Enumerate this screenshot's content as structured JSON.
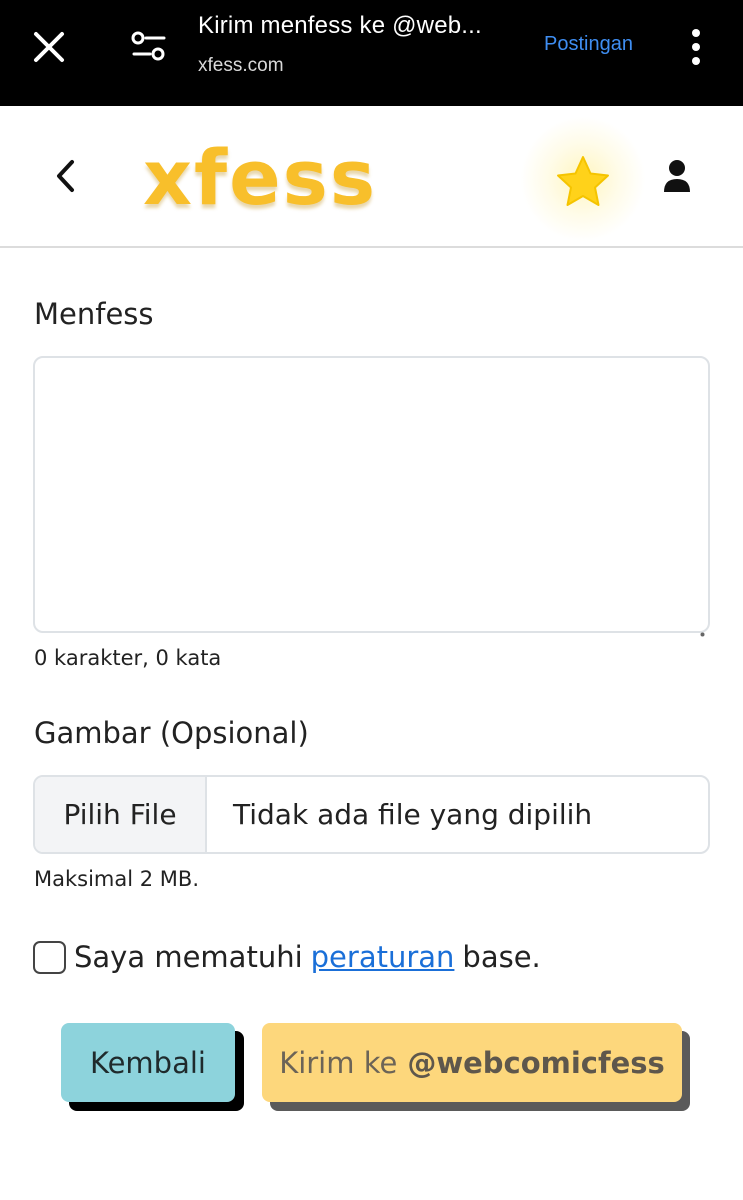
{
  "browser_bar": {
    "title": "Kirim menfess ke @web...",
    "domain": "xfess.com",
    "action_link": "Postingan",
    "icons": [
      "close-icon",
      "page-settings-icon",
      "more-vert-icon"
    ]
  },
  "header": {
    "logo_text": "xfess",
    "icons": [
      "back-chevron-icon",
      "star-icon",
      "user-icon"
    ],
    "colors": {
      "logo": "#f8bf2b",
      "star": "#ffd21a"
    }
  },
  "form": {
    "menfess_label": "Menfess",
    "menfess_value": "",
    "char_count": "0 karakter, 0 kata",
    "image_label": "Gambar (Opsional)",
    "file_button": "Pilih File",
    "file_status": "Tidak ada file yang dipilih",
    "max_size": "Maksimal 2 MB.",
    "agree_prefix": "Saya mematuhi",
    "agree_link": "peraturan",
    "agree_suffix": "base.",
    "agree_checked": false
  },
  "actions": {
    "back_label": "Kembali",
    "send_prefix": "Kirim ke",
    "send_target": "@webcomicfess",
    "colors": {
      "back": "#8dd3dc",
      "send": "#fdd77c"
    }
  }
}
